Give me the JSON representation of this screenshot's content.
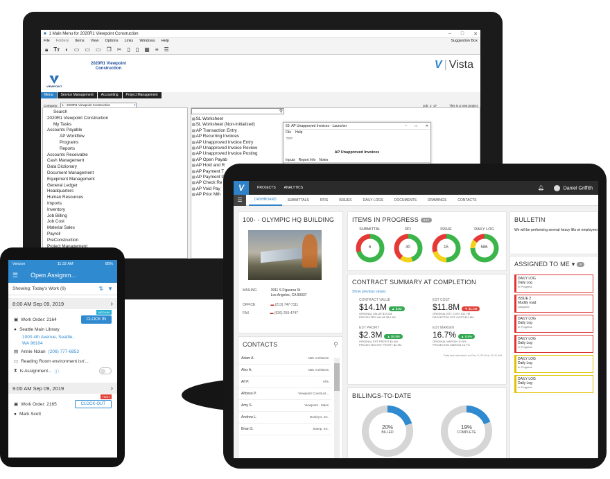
{
  "desktop": {
    "window_title": "1 Main Menu for 2020R1 Viewpoint Construction",
    "menu": [
      "File",
      "Folders",
      "Items",
      "View",
      "Options",
      "Links",
      "Windows",
      "Help"
    ],
    "suggestion_box": "Suggestion Box",
    "logo_text": "VIEWPOINT",
    "app_title_1": "2020R1 Viewpoint",
    "app_title_2": "Construction",
    "vista_label": "Vista",
    "nav": [
      "Menu",
      "Service Management",
      "Accounting",
      "Project Management"
    ],
    "company_label": "Company:",
    "company_value": "1 - 2020R1 Viewpoint Construction",
    "job_label": "Job:",
    "job_value": "1- 17",
    "new_project": "This is a new project",
    "tree": [
      {
        "t": "Search",
        "l": 2
      },
      {
        "t": "2020R1 Viewpoint Construction",
        "l": 1
      },
      {
        "t": "My Tasks",
        "l": 2
      },
      {
        "t": "Accounts Payable",
        "l": 1
      },
      {
        "t": "AP Workflow",
        "l": 3
      },
      {
        "t": "Programs",
        "l": 3
      },
      {
        "t": "Reports",
        "l": 3
      },
      {
        "t": "Accounts Receivable",
        "l": 1
      },
      {
        "t": "Cash Management",
        "l": 1
      },
      {
        "t": "Data Dictionary",
        "l": 1
      },
      {
        "t": "Document Management",
        "l": 1
      },
      {
        "t": "Equipment Management",
        "l": 1
      },
      {
        "t": "General Ledger",
        "l": 1
      },
      {
        "t": "Headquarters",
        "l": 1
      },
      {
        "t": "Human Resources",
        "l": 1
      },
      {
        "t": "Imports",
        "l": 1
      },
      {
        "t": "Inventory",
        "l": 1
      },
      {
        "t": "Job Billing",
        "l": 1
      },
      {
        "t": "Job Cost",
        "l": 1
      },
      {
        "t": "Material Sales",
        "l": 1
      },
      {
        "t": "Payroll",
        "l": 1
      },
      {
        "t": "PreConstruction",
        "l": 1
      },
      {
        "t": "Project Management",
        "l": 1
      }
    ],
    "right_list": [
      "SL Worksheet",
      "SL Worksheet (Non-Initialized)",
      "AP Transaction Entry",
      "AP Recurring Invoices",
      "AP Unapproved Invoice Entry",
      "AP Unapproved Invoice Review",
      "AP Unapproved Invoice Posting",
      "AP Open Payab",
      "AP Hold and R",
      "AP Payment T",
      "AP Payment P",
      "AP Check Re",
      "AP Void Pay",
      "AP Prior Mth"
    ],
    "launcher": {
      "title": "63: AP Unapproved Invoices - Launcher",
      "menu": [
        "File",
        "Help"
      ],
      "heading": "AP Unapproved Invoices",
      "tabs": [
        "Inputs",
        "Report Info",
        "Notes"
      ]
    }
  },
  "tablet": {
    "top_tabs": [
      "PROJECTS",
      "ANALYTICS"
    ],
    "user": "Daniel Griffith",
    "tabs": [
      "DASHBOARD",
      "SUBMITTALS",
      "RFIS",
      "ISSUES",
      "DAILY LOGS",
      "DOCUMENTS",
      "DRAWINGS",
      "CONTACTS"
    ],
    "project_title": "100- - OLYMPIC HQ BUILDING",
    "mailing_label": "MAILING",
    "address_1": "3911 S Figueroa St",
    "address_2": "Los Angeles, CA 90037",
    "office_label": "OFFICE",
    "office_phone": "(213) 747-7111",
    "fax_label": "FAX",
    "fax_phone": "(626) 255-4747",
    "items_title": "ITEMS IN PROGRESS",
    "items_count": "647",
    "donuts": [
      {
        "label": "SUBMITTAL",
        "value": "6"
      },
      {
        "label": "RFI",
        "value": "40"
      },
      {
        "label": "ISSUE",
        "value": "15"
      },
      {
        "label": "DAILY LOG",
        "value": "586"
      }
    ],
    "contract_title": "CONTRACT SUMMARY AT COMPLETION",
    "show_prev": "Show previous values",
    "metrics": [
      {
        "label": "CONTRACT VALUE",
        "value": "$14.1M",
        "delta": "$1M",
        "dir": "up",
        "l1": "ORIGINAL VALUE $13.1M",
        "l2": "PROJECTED VALUE $14.1M"
      },
      {
        "label": "EST COST",
        "value": "$11.8M",
        "delta": "$1.0M",
        "dir": "down",
        "l1": "ORIGINAL EST COST $11.7M",
        "l2": "PROJECTED EST COST $11.8M"
      },
      {
        "label": "EST PROFIT",
        "value": "$2.3M",
        "delta": "$0.9M",
        "dir": "up",
        "l1": "ORIGINAL EST PROFIT $1.4M",
        "l2": "PROJECTED EST PROFIT $2.3M"
      },
      {
        "label": "EST MARGIN",
        "value": "16.7%",
        "delta": "5.8%",
        "dir": "up",
        "l1": "ORIGINAL MARGIN 10.9%",
        "l2": "PROJECTED MARGIN 16.7%"
      }
    ],
    "refreshed": "Data last refreshed on Dec 9, 2019 at 10:11 AM",
    "contacts_title": "CONTACTS",
    "contacts": [
      {
        "name": "Adam A.",
        "company": "ABC Architects"
      },
      {
        "name": "Alex A.",
        "company": "ABC Architects"
      },
      {
        "name": "Alf P.",
        "company": "Alf's"
      },
      {
        "name": "Alfonso P.",
        "company": "Viewpoint Construct..."
      },
      {
        "name": "Amy S.",
        "company": "Viewpoint - Sales"
      },
      {
        "name": "Andrew L.",
        "company": "Donley's, Inc."
      },
      {
        "name": "Brian S.",
        "company": "Stamp, Inc."
      }
    ],
    "billings_title": "BILLINGS-TO-DATE",
    "billings": [
      {
        "pct": "20%",
        "label": "BILLED",
        "value": 20
      },
      {
        "pct": "19%",
        "label": "COMPLETE",
        "value": 19
      }
    ],
    "bulletin_title": "BULLETIN",
    "bulletin_text": "We will be performing several heavy lifts wi employees must attend today's MANDATOR",
    "assigned_title": "ASSIGNED TO ME",
    "assigned_count": "8",
    "assigned": [
      {
        "t": "DAILY LOG",
        "s": "Daily Log",
        "st": "In Progress",
        "c": "r"
      },
      {
        "t": "ISSUE 2",
        "s": "Muddy road",
        "st": "Assigned",
        "c": "r"
      },
      {
        "t": "DAILY LOG",
        "s": "Daily Log",
        "st": "In Progress",
        "c": "r"
      },
      {
        "t": "DAILY LOG",
        "s": "Daily Log",
        "st": "In Progress",
        "c": "r"
      },
      {
        "t": "DAILY LOG",
        "s": "Daily Log",
        "st": "In Progress",
        "c": "y"
      },
      {
        "t": "DAILY LOG",
        "s": "Daily Log",
        "st": "In Progress",
        "c": "y"
      }
    ]
  },
  "phone": {
    "carrier": "Verizon",
    "time": "11:32 AM",
    "battery": "85%",
    "title": "Open Assignm...",
    "showing": "Showing: Today's Work (6)",
    "work_orders": [
      {
        "date": "8:00 AM Sep 09, 2019",
        "priority": "MEDIUM",
        "prio_color": "#2bb3d6",
        "wo": "Work Order: 2164",
        "btn": "CLOCK IN",
        "place": "Seattle Main Library",
        "addr1": "1000 4th Avenue, Seattle,",
        "addr2": "WA 98104",
        "contact": "Annie Nolan",
        "phone": "(206) 777-6853",
        "note": "Reading Room environment isn'...",
        "assign": "Is Assignment..."
      },
      {
        "date": "9:00 AM Sep 09, 2019",
        "priority": "HIGH",
        "prio_color": "#e0433b",
        "wo": "Work Order: 2165",
        "btn": "CLOCK-OUT",
        "place": "Mark Scott"
      }
    ]
  }
}
